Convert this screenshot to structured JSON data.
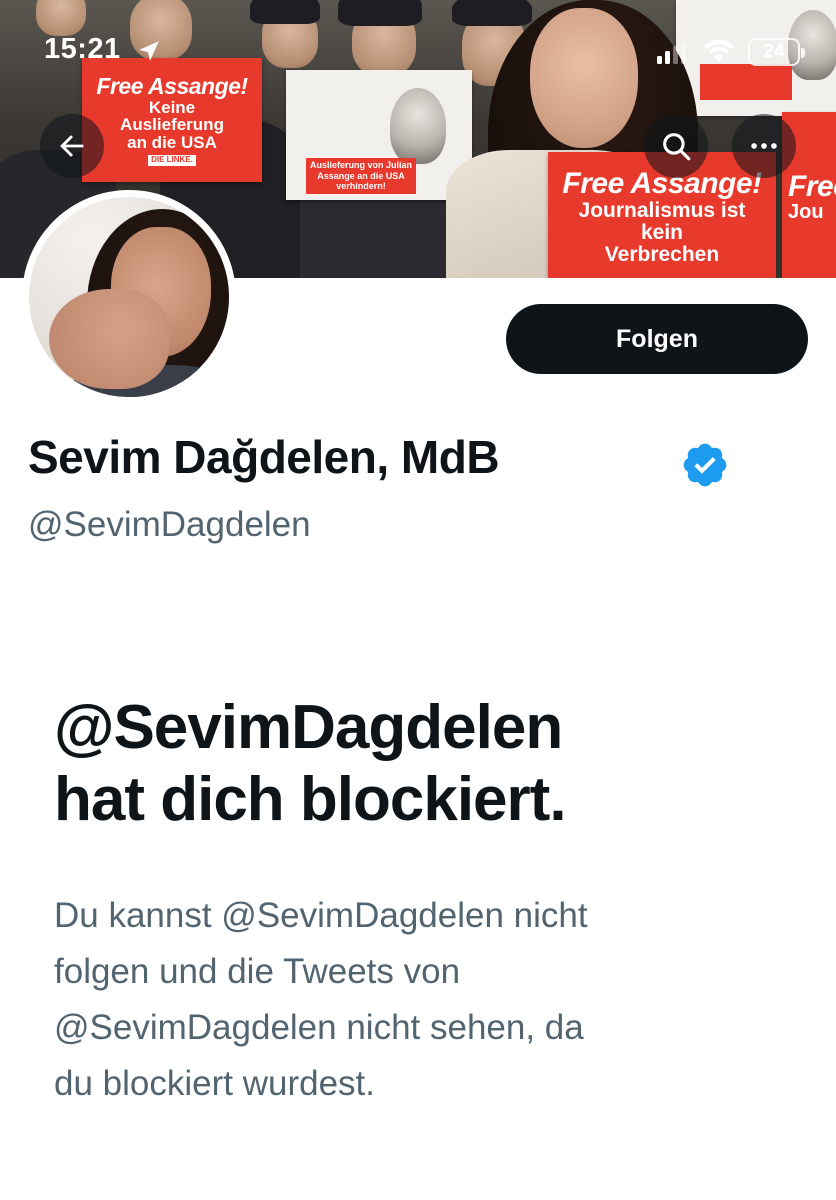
{
  "status_bar": {
    "time": "15:21",
    "battery": "24"
  },
  "banner": {
    "sign_left_title": "Free Assange!",
    "sign_left_line1": "Keine",
    "sign_left_line2": "Auslieferung",
    "sign_left_line3": "an die USA",
    "sign_left_tag": "DIE LINKE.",
    "placard_text": "Auslieferung von Julian Assange an die USA verhindern!",
    "sign_right_title": "Free Assange!",
    "sign_right_line1": "Journalismus ist",
    "sign_right_line2": "kein",
    "sign_right_line3": "Verbrechen",
    "sign_edge_title": "Free",
    "sign_edge_line": "Jou"
  },
  "icons": {
    "back": "back-arrow-icon",
    "search": "search-icon",
    "more": "more-icon",
    "verified": "verified-badge-icon"
  },
  "profile": {
    "follow_label": "Folgen",
    "display_name": "Sevim Dağdelen, MdB",
    "handle": "@SevimDagdelen"
  },
  "blocked": {
    "title_line1": "@SevimDagdelen",
    "title_line2": "hat dich blockiert.",
    "desc_line1": "Du kannst @SevimDagdelen nicht",
    "desc_line2": "folgen und die Tweets von",
    "desc_line3": "@SevimDagdelen nicht sehen, da",
    "desc_line4": "du blockiert wurdest."
  },
  "colors": {
    "accent_verified": "#1d9bf0",
    "text_primary": "#0f1419",
    "text_secondary": "#536471",
    "follow_button_bg": "#0f1419",
    "sign_red": "#e8392d"
  }
}
